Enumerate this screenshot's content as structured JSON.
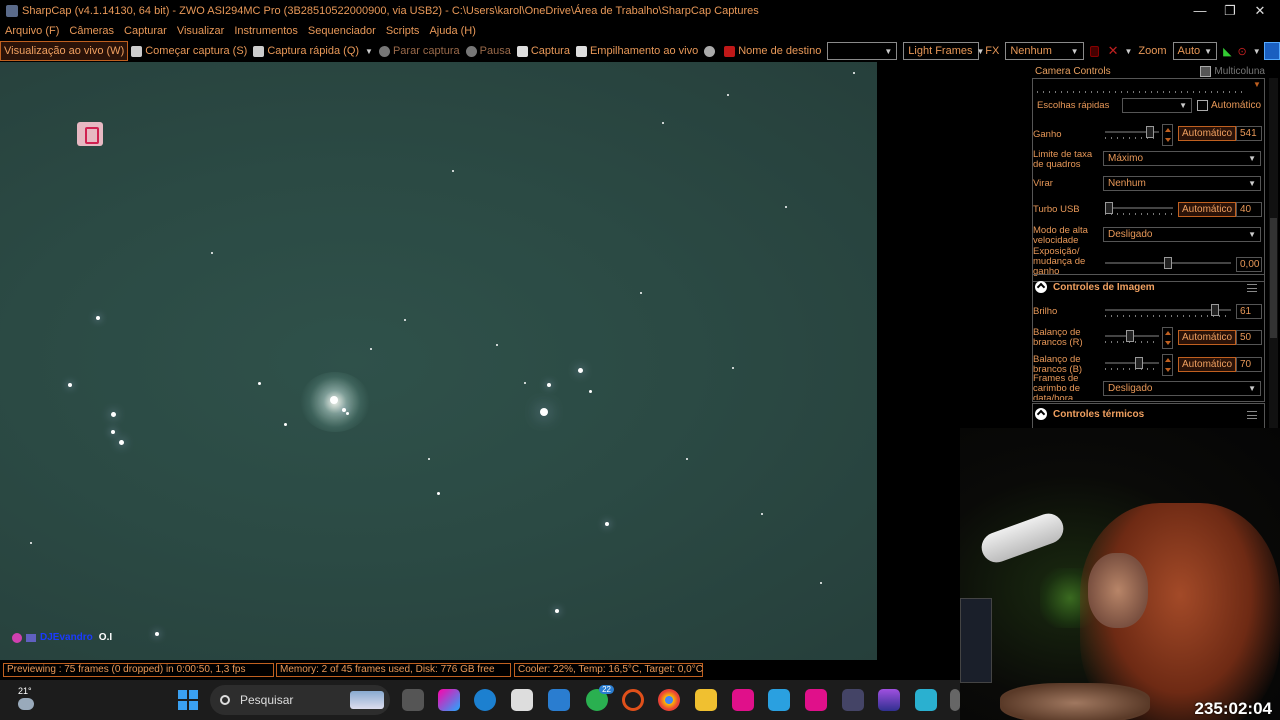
{
  "window": {
    "title": "SharpCap (v4.1.14130, 64 bit) - ZWO ASI294MC Pro (3B28510522000900, via USB2) - C:\\Users\\karol\\OneDrive\\Área de Trabalho\\SharpCap Captures",
    "minimize": "—",
    "maximize": "❐",
    "close": "✕"
  },
  "menu": [
    "Arquivo (F)",
    "Câmeras",
    "Capturar",
    "Visualizar",
    "Instrumentos",
    "Sequenciador",
    "Scripts",
    "Ajuda (H)"
  ],
  "toolbar": {
    "live_view": "Visualização ao vivo (W)",
    "start_capture": "Começar captura (S)",
    "quick_capture": "Captura rápida (Q)",
    "stop_capture": "Parar captura",
    "pause": "Pausa",
    "capture": "Captura",
    "live_stack": "Empilhamento ao vivo",
    "target_name_label": "Nome de destino",
    "target_name_value": "",
    "frame_type": "Light Frames",
    "fx_label": "FX",
    "fx_value": "Nenhum",
    "zoom_label": "Zoom",
    "zoom_value": "Auto"
  },
  "viewer": {
    "chat_user": "DJEvandro",
    "chat_message": "O.I"
  },
  "panel": {
    "title": "Camera Controls",
    "multicolumn": "Multicoluna",
    "quick_picks_label": "Escolhas rápidas",
    "quick_picks_auto": "Automático",
    "gain_label": "Ganho",
    "gain_auto": "Automático",
    "gain_value": "541",
    "gain_level": 0.9,
    "frame_rate_label": "Limite de taxa de quadros",
    "frame_rate_value": "Máximo",
    "flip_label": "Virar",
    "flip_value": "Nenhum",
    "usb_turbo_label": "Turbo USB",
    "usb_turbo_auto": "Automático",
    "usb_turbo_value": "40",
    "usb_turbo_level": 0.0,
    "high_speed_label": "Modo de alta velocidade",
    "high_speed_value": "Desligado",
    "exposure_gain_label": "Exposição/ mudança de ganho",
    "exposure_gain_value": "0,00",
    "exposure_gain_level": 0.5,
    "image_controls_title": "Controles de Imagem",
    "brightness_label": "Brilho",
    "brightness_value": "61",
    "brightness_level": 0.9,
    "wb_r_label": "Balanço de brancos (R)",
    "wb_r_auto": "Automático",
    "wb_r_value": "50",
    "wb_r_level": 0.45,
    "wb_b_label": "Balanço de brancos (B)",
    "wb_b_auto": "Automático",
    "wb_b_value": "70",
    "wb_b_level": 0.65,
    "timestamp_label": "Frames de carimbo de data/hora",
    "timestamp_value": "Desligado",
    "thermal_title": "Controles térmicos"
  },
  "status": {
    "preview": "Previewing : 75 frames (0 dropped) in 0:00:50, 1,3 fps",
    "memory": "Memory: 2 of 45 frames used, Disk: 776 GB free",
    "cooler": "Cooler: 22%, Temp: 16,5°C, Target: 0,0°C"
  },
  "taskbar": {
    "weather_temp": "21°",
    "search_placeholder": "Pesquisar",
    "whatsapp_badge": "22"
  },
  "stream": {
    "timer": "235:02:04"
  },
  "colors": {
    "accent": "#e89858",
    "sky": "#2b4a44",
    "active_border": "#c06020"
  }
}
